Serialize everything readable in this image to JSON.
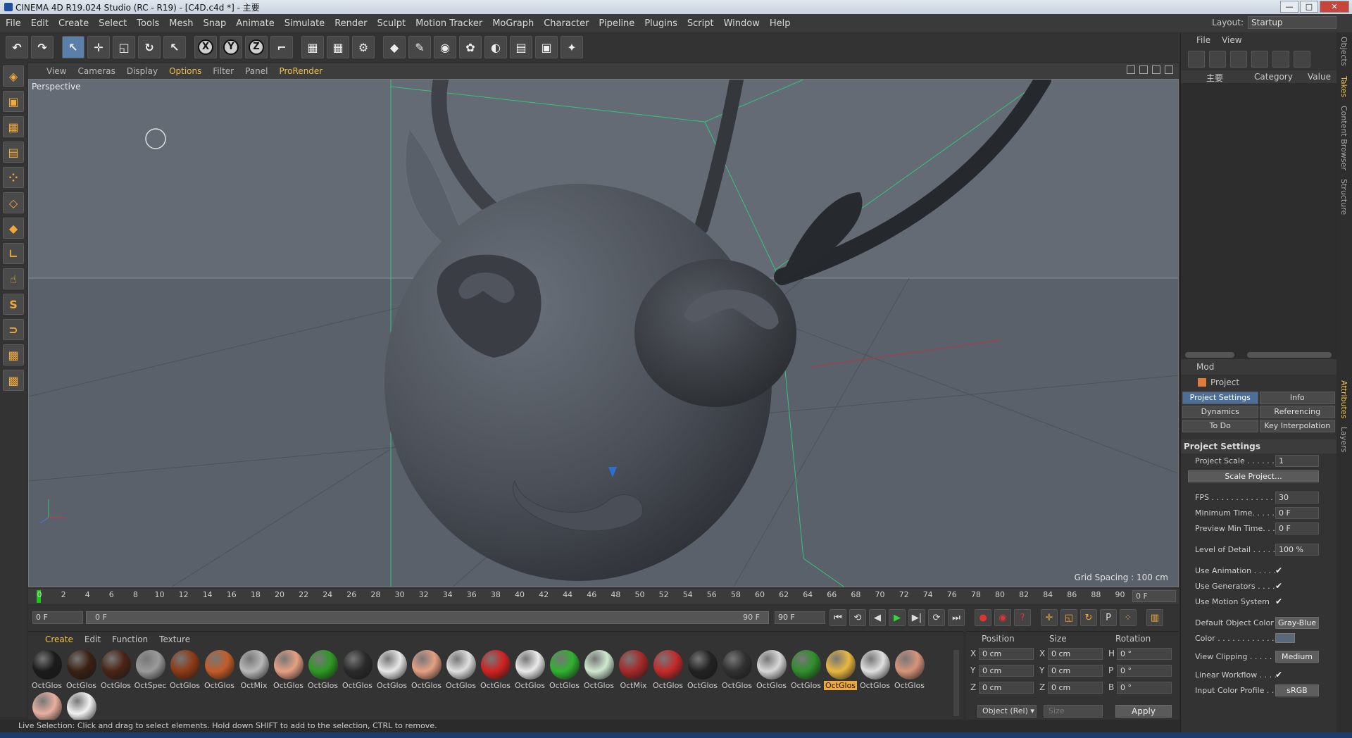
{
  "window": {
    "title": "CINEMA 4D R19.024 Studio (RC - R19) - [C4D.c4d *] - 主要",
    "btn_min": "—",
    "btn_max": "□",
    "btn_close": "✕"
  },
  "menubar": {
    "items": [
      "File",
      "Edit",
      "Create",
      "Select",
      "Tools",
      "Mesh",
      "Snap",
      "Animate",
      "Simulate",
      "Render",
      "Sculpt",
      "Motion Tracker",
      "MoGraph",
      "Character",
      "Pipeline",
      "Plugins",
      "Script",
      "Window",
      "Help"
    ],
    "layout_label": "Layout:",
    "layout_value": "Startup"
  },
  "toolbar": {
    "axis_x": "X",
    "axis_y": "Y",
    "axis_z": "Z"
  },
  "viewport": {
    "menu": [
      "View",
      "Cameras",
      "Display",
      "Options",
      "Filter",
      "Panel",
      "ProRender"
    ],
    "highlight_index": 3,
    "camera_label": "Perspective",
    "grid_spacing": "Grid Spacing : 100 cm",
    "colors": {
      "background": "#5d6570",
      "bounding_box": "#34c47a",
      "mesh": "#44484f"
    }
  },
  "timeline": {
    "ticks": [
      "0",
      "2",
      "4",
      "6",
      "8",
      "10",
      "12",
      "14",
      "16",
      "18",
      "20",
      "22",
      "24",
      "26",
      "28",
      "30",
      "32",
      "34",
      "36",
      "38",
      "40",
      "42",
      "44",
      "46",
      "48",
      "50",
      "52",
      "54",
      "56",
      "58",
      "60",
      "62",
      "64",
      "66",
      "68",
      "70",
      "72",
      "74",
      "76",
      "78",
      "80",
      "82",
      "84",
      "86",
      "88",
      "90"
    ],
    "current_frame_field": "0 F"
  },
  "transport": {
    "start_field": "0 F",
    "slider_start": "0 F",
    "slider_end": "90 F",
    "end_field": "90 F",
    "buttons": [
      "⏮",
      "⟲",
      "◀",
      "▶",
      "▶|",
      "⟳",
      "⏭"
    ]
  },
  "materials": {
    "menu": [
      "Create",
      "Edit",
      "Function",
      "Texture"
    ],
    "items": [
      {
        "name": "OctGlos",
        "color": "#1a1a1a"
      },
      {
        "name": "OctGlos",
        "color": "#3a2012"
      },
      {
        "name": "OctGlos",
        "color": "#4a2416"
      },
      {
        "name": "OctSpec",
        "color": "#9a9a9a"
      },
      {
        "name": "OctGlos",
        "color": "#8e3a14"
      },
      {
        "name": "OctGlos",
        "color": "#c45c28"
      },
      {
        "name": "OctMix",
        "color": "#b8b8b8"
      },
      {
        "name": "OctGlos",
        "color": "#e6a082"
      },
      {
        "name": "OctGlos",
        "color": "#2d9a22"
      },
      {
        "name": "OctGlos",
        "color": "#2a2a2a"
      },
      {
        "name": "OctGlos",
        "color": "#e8e8e8"
      },
      {
        "name": "OctGlos",
        "color": "#e6a082"
      },
      {
        "name": "OctGlos",
        "color": "#e0e0e0"
      },
      {
        "name": "OctGlos",
        "color": "#d12222"
      },
      {
        "name": "OctGlos",
        "color": "#eaeaea"
      },
      {
        "name": "OctGlos",
        "color": "#2fb22f"
      },
      {
        "name": "OctGlos",
        "color": "#d0e8d0"
      },
      {
        "name": "OctMix",
        "color": "#a82828"
      },
      {
        "name": "OctGlos",
        "color": "#c42a2a"
      },
      {
        "name": "OctGlos",
        "color": "#222222"
      },
      {
        "name": "OctGlos",
        "color": "#303030"
      },
      {
        "name": "OctGlos",
        "color": "#d8d8d8"
      },
      {
        "name": "OctGlos",
        "color": "#2f8f2a"
      },
      {
        "name": "OctGlos",
        "color": "#e8b840"
      },
      {
        "name": "OctGlos",
        "color": "#e0e0e0"
      },
      {
        "name": "OctGlos",
        "color": "#d6947a"
      },
      {
        "name": "",
        "color": "#e8b0a0"
      },
      {
        "name": "",
        "color": "#f2f2f2"
      }
    ],
    "selected_index": 23
  },
  "coords": {
    "head_position": "Position",
    "head_size": "Size",
    "head_rotation": "Rotation",
    "rows": [
      {
        "a1": "X",
        "v1": "0 cm",
        "a2": "X",
        "v2": "0 cm",
        "a3": "H",
        "v3": "0 °"
      },
      {
        "a1": "Y",
        "v1": "0 cm",
        "a2": "Y",
        "v2": "0 cm",
        "a3": "P",
        "v3": "0 °"
      },
      {
        "a1": "Z",
        "v1": "0 cm",
        "a2": "Z",
        "v2": "0 cm",
        "a3": "B",
        "v3": "0 °"
      }
    ],
    "mode_dropdown": "Object (Rel) ▾",
    "size_dropdown": "Size",
    "apply": "Apply"
  },
  "status": "Live Selection: Click and drag to select elements. Hold down SHIFT to add to the selection, CTRL to remove.",
  "object_manager": {
    "menu": [
      "File",
      "View"
    ],
    "col_name": "主要",
    "col_category": "Category",
    "col_value": "Value"
  },
  "attributes": {
    "mode": "Mod",
    "title": "Project",
    "tabs": [
      "Project Settings",
      "Info",
      "Dynamics",
      "Referencing",
      "To Do",
      "Key Interpolation"
    ],
    "section": "Project Settings",
    "rows": {
      "project_scale": {
        "label": "Project Scale . . . . . .",
        "value": "1"
      },
      "scale_project": "Scale Project...",
      "fps": {
        "label": "FPS . . . . . . . . . . . . .",
        "value": "30"
      },
      "min_time": {
        "label": "Minimum Time. . . . . .",
        "value": "0 F"
      },
      "preview_min": {
        "label": "Preview Min Time. . . .",
        "value": "0 F"
      },
      "lod": {
        "label": "Level of Detail . . . . .",
        "value": "100 %"
      },
      "use_animation": {
        "label": "Use Animation . . . . .",
        "value": "✔"
      },
      "use_generators": {
        "label": "Use Generators . . . .",
        "value": "✔"
      },
      "use_motion": {
        "label": "Use Motion System",
        "value": "✔"
      },
      "default_color": {
        "label": "Default Object Color",
        "value": "Gray-Blue"
      },
      "color": {
        "label": "Color . . . . . . . . . . . ."
      },
      "view_clipping": {
        "label": "View Clipping . . . . . .",
        "value": "Medium"
      },
      "linear_workflow": {
        "label": "Linear Workflow . . . .",
        "value": "✔"
      },
      "input_profile": {
        "label": "Input Color Profile . .",
        "value": "sRGB"
      }
    }
  },
  "sidetabs": [
    "Objects",
    "Takes",
    "Content Browser",
    "Structure",
    "Attributes",
    "Layers"
  ]
}
